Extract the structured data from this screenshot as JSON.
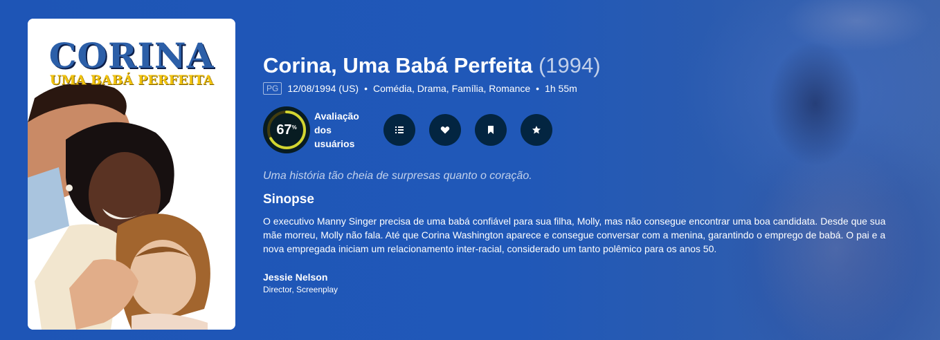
{
  "poster": {
    "title_line1": "CORINA",
    "title_line2": "UMA BABÁ PERFEITA"
  },
  "movie": {
    "title": "Corina, Uma Babá Perfeita",
    "year": "(1994)",
    "certification": "PG",
    "release": "12/08/1994 (US)",
    "genres": "Comédia, Drama, Família, Romance",
    "runtime": "1h 55m",
    "separator": "•"
  },
  "score": {
    "value": "67",
    "unit": "%",
    "percent": 67,
    "label": "Avaliação dos usuários",
    "ring_color": "#d2d531",
    "track_color": "#423d0f"
  },
  "actions": [
    {
      "icon": "list-icon",
      "label": "Adicionar à lista"
    },
    {
      "icon": "heart-icon",
      "label": "Marcar como favorito"
    },
    {
      "icon": "bookmark-icon",
      "label": "Adicionar à sua lista de interesses"
    },
    {
      "icon": "star-icon",
      "label": "Avalie!"
    }
  ],
  "tagline": "Uma história tão cheia de surpresas quanto o coração.",
  "overview_title": "Sinopse",
  "overview": "O executivo Manny Singer precisa de uma babá confiável para sua filha, Molly, mas não consegue encontrar uma boa candidata. Desde que sua mãe morreu, Molly não fala. Até que Corina Washington aparece e consegue conversar com a menina, garantindo o emprego de babá. O pai e a nova empregada iniciam um relacionamento inter-racial, considerado um tanto polêmico para os anos 50.",
  "crew": [
    {
      "name": "Jessie Nelson",
      "role": "Director, Screenplay"
    }
  ],
  "colors": {
    "background": "#1f4fa6",
    "button_bg": "#032541"
  }
}
